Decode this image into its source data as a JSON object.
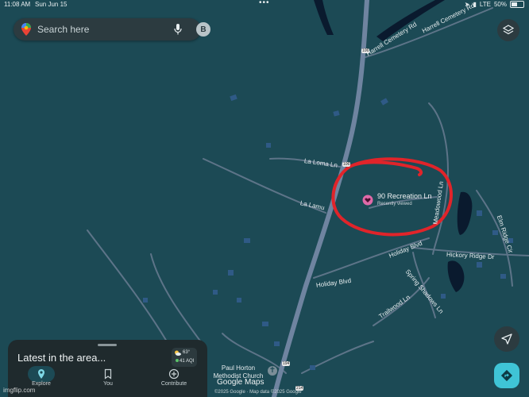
{
  "status_bar": {
    "time": "11:08 AM",
    "date": "Sun Jun 15",
    "network": "LTE",
    "battery": "50%",
    "battery_level": 0.5
  },
  "search": {
    "placeholder": "Search here",
    "avatar_initial": "B",
    "icons": [
      "maps-pin-icon",
      "mic-icon"
    ]
  },
  "controls": {
    "layers_icon": "layers-icon",
    "compass_icon": "navigation-arrow-icon",
    "directions_icon": "directions-icon"
  },
  "map": {
    "roads": [
      "Harrell Cemetery Rd",
      "Harrell Cemetery Rd",
      "La Loma Ln",
      "La Lamu",
      "Meadowood Ln",
      "Holiday Blvd",
      "Holiday Blvd",
      "Hickory Ridge Dr",
      "Elm Ridge Cir",
      "Spring Shadows Ln",
      "Trailwood Ln"
    ],
    "route_shields": [
      "106",
      "106",
      "194",
      "214"
    ],
    "poi": "Paul Horton Methodist Church",
    "selected_place": {
      "name": "90 Recreation Ln",
      "subtitle": "Recently viewed"
    }
  },
  "bottom_sheet": {
    "title": "Latest in the area...",
    "weather_temp": "63°",
    "aqi": "41 AQI"
  },
  "nav": [
    {
      "label": "Explore",
      "icon": "location-pin-icon",
      "active": true
    },
    {
      "label": "You",
      "icon": "bookmark-icon",
      "active": false
    },
    {
      "label": "Contribute",
      "icon": "plus-circle-icon",
      "active": false
    }
  ],
  "footer": {
    "logo": "Google Maps",
    "copyright": "©2025 Google · Map data ©2025 Google"
  },
  "watermark": "imgflip.com",
  "colors": {
    "map_background": "#1c4a55",
    "road": "#5d7488",
    "highway": "#6f84a0",
    "water": "#0a1a2e",
    "annotation_circle": "#e0242a",
    "selected_pin": "#e06aa8",
    "directions_button": "#3fc4d6"
  }
}
